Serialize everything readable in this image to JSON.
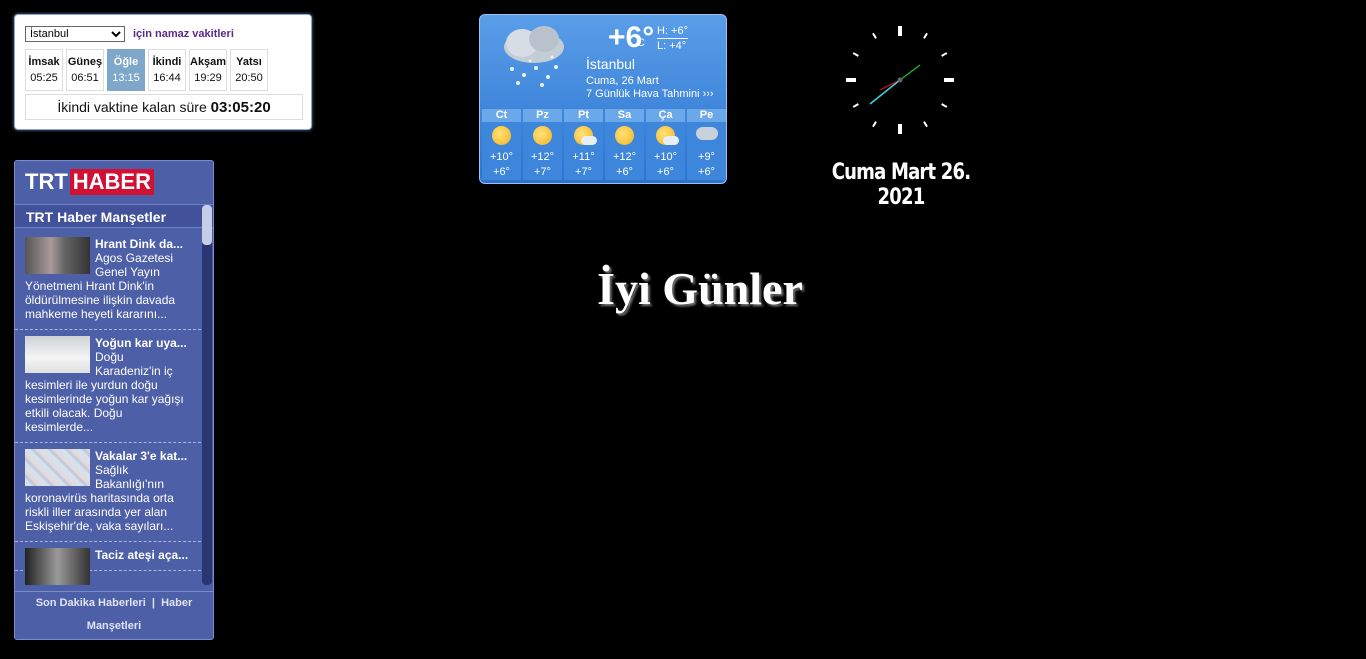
{
  "prayer": {
    "city": "İstanbul",
    "title": "için namaz vakitleri",
    "times": [
      {
        "name": "İmsak",
        "time": "05:25"
      },
      {
        "name": "Güneş",
        "time": "06:51"
      },
      {
        "name": "Öğle",
        "time": "13:15",
        "active": true
      },
      {
        "name": "İkindi",
        "time": "16:44"
      },
      {
        "name": "Akşam",
        "time": "19:29"
      },
      {
        "name": "Yatsı",
        "time": "20:50"
      }
    ],
    "remain_label": "İkindi vaktine kalan süre",
    "remain_time": "03:05:20"
  },
  "weather": {
    "temp": "+6°",
    "unit": "C",
    "high": "H: +6°",
    "low": "L: +4°",
    "city": "İstanbul",
    "date": "Cuma, 26 Mart",
    "forecast_link": "7 Günlük Hava Tahmini",
    "days": [
      {
        "day": "Ct",
        "icon": "sun-icon",
        "hi": "+10°",
        "lo": "+6°"
      },
      {
        "day": "Pz",
        "icon": "sun-icon",
        "hi": "+12°",
        "lo": "+7°"
      },
      {
        "day": "Pt",
        "icon": "partly-cloudy-icon",
        "hi": "+11°",
        "lo": "+7°"
      },
      {
        "day": "Sa",
        "icon": "sun-icon",
        "hi": "+12°",
        "lo": "+6°"
      },
      {
        "day": "Ça",
        "icon": "partly-cloudy-icon",
        "hi": "+10°",
        "lo": "+6°"
      },
      {
        "day": "Pe",
        "icon": "rain-icon",
        "hi": "+9°",
        "lo": "+6°"
      }
    ]
  },
  "clock": {
    "date": "Cuma Mart 26. 2021"
  },
  "greeting": "İyi Günler",
  "news": {
    "logo_trt": "TRT",
    "logo_haber": "HABER",
    "header": "TRT Haber Manşetler",
    "items": [
      {
        "title": "Hrant Dink da...",
        "text": "Agos Gazetesi Genel Yayın Yönetmeni Hrant Dink'in öldürülmesine ilişkin davada mahkeme heyeti kararını..."
      },
      {
        "title": "Yoğun kar uya...",
        "text": "Doğu Karadeniz'in iç kesimleri ile yurdun doğu kesimlerinde yoğun kar yağışı etkili olacak. Doğu kesimlerde..."
      },
      {
        "title": "Vakalar 3'e kat...",
        "text": "Sağlık Bakanlığı'nın koronavirüs haritasında orta riskli iller arasında yer alan Eskişehir'de, vaka sayıları..."
      },
      {
        "title": "Taciz ateşi aça...",
        "text": ""
      }
    ],
    "footer_link1": "Son Dakika Haberleri",
    "footer_sep": "|",
    "footer_link2": "Haber Manşetleri"
  }
}
